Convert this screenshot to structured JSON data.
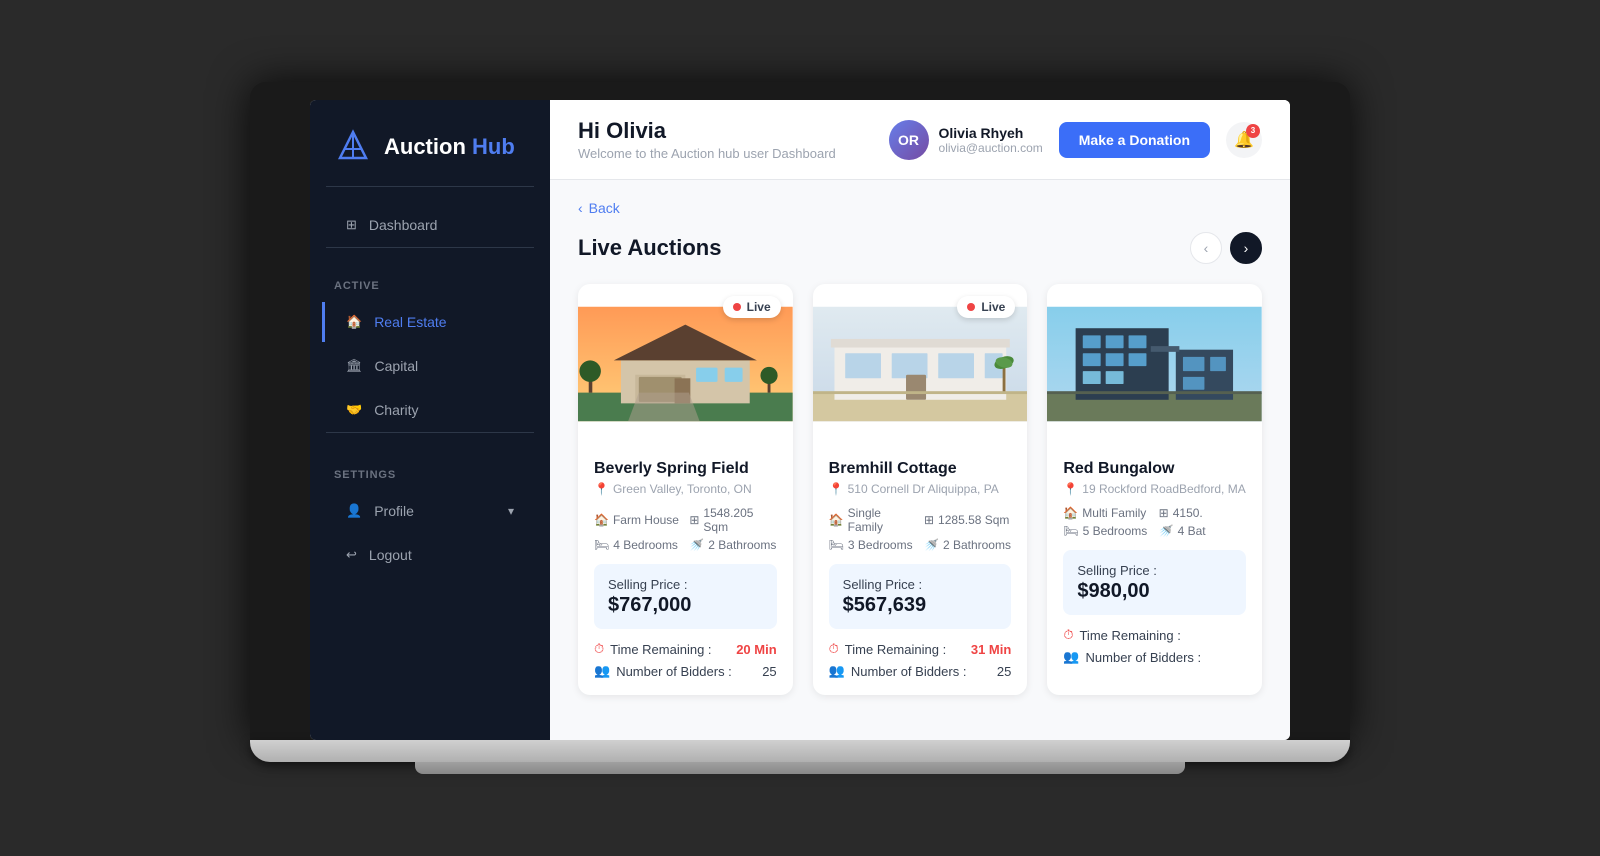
{
  "logo": {
    "text_white": "Auction",
    "text_blue": "Hub"
  },
  "sidebar": {
    "nav": {
      "dashboard_label": "Dashboard"
    },
    "active_section_label": "Active",
    "active_items": [
      {
        "id": "real-estate",
        "label": "Real Estate",
        "active": true
      },
      {
        "id": "capital",
        "label": "Capital",
        "active": false
      },
      {
        "id": "charity",
        "label": "Charity",
        "active": false
      }
    ],
    "settings_label": "SETTINGS",
    "settings_items": [
      {
        "id": "profile",
        "label": "Profile"
      },
      {
        "id": "logout",
        "label": "Logout"
      }
    ]
  },
  "header": {
    "greeting": "Hi Olivia",
    "subtitle": "Welcome to the Auction hub user Dashboard",
    "user_name": "Olivia Rhyeh",
    "user_email": "olivia@auction.com",
    "user_initials": "OR",
    "donate_btn": "Make a Donation",
    "notif_count": "3"
  },
  "content": {
    "back_label": "Back",
    "section_title": "Live Auctions",
    "cards": [
      {
        "id": "card-1",
        "title": "Beverly Spring Field",
        "location": "Green Valley, Toronto, ON",
        "live": true,
        "live_label": "Live",
        "property_type": "Farm House",
        "area": "1548.205 Sqm",
        "bedrooms": "4 Bedrooms",
        "bathrooms": "2 Bathrooms",
        "price_label": "Selling Price :",
        "price": "$767,000",
        "time_label": "Time Remaining :",
        "time_value": "20 Min",
        "bidders_label": "Number of Bidders :",
        "bidders_count": "25",
        "image_type": "house1"
      },
      {
        "id": "card-2",
        "title": "Bremhill Cottage",
        "location": "510 Cornell Dr Aliquippa, PA",
        "live": true,
        "live_label": "Live",
        "property_type": "Single Family",
        "area": "1285.58 Sqm",
        "bedrooms": "3 Bedrooms",
        "bathrooms": "2 Bathrooms",
        "price_label": "Selling Price :",
        "price": "$567,639",
        "time_label": "Time Remaining :",
        "time_value": "31 Min",
        "bidders_label": "Number of Bidders :",
        "bidders_count": "25",
        "image_type": "house2"
      },
      {
        "id": "card-3",
        "title": "Red Bungalow",
        "location": "19 Rockford RoadBedford, MA",
        "live": false,
        "live_label": "",
        "property_type": "Multi Family",
        "area": "4150.",
        "bedrooms": "5 Bedrooms",
        "bathrooms": "4 Bat",
        "price_label": "Selling Price :",
        "price": "$980,00",
        "time_label": "Time Remaining :",
        "time_value": "",
        "bidders_label": "Number of Bidders :",
        "bidders_count": "",
        "image_type": "house3"
      }
    ]
  }
}
